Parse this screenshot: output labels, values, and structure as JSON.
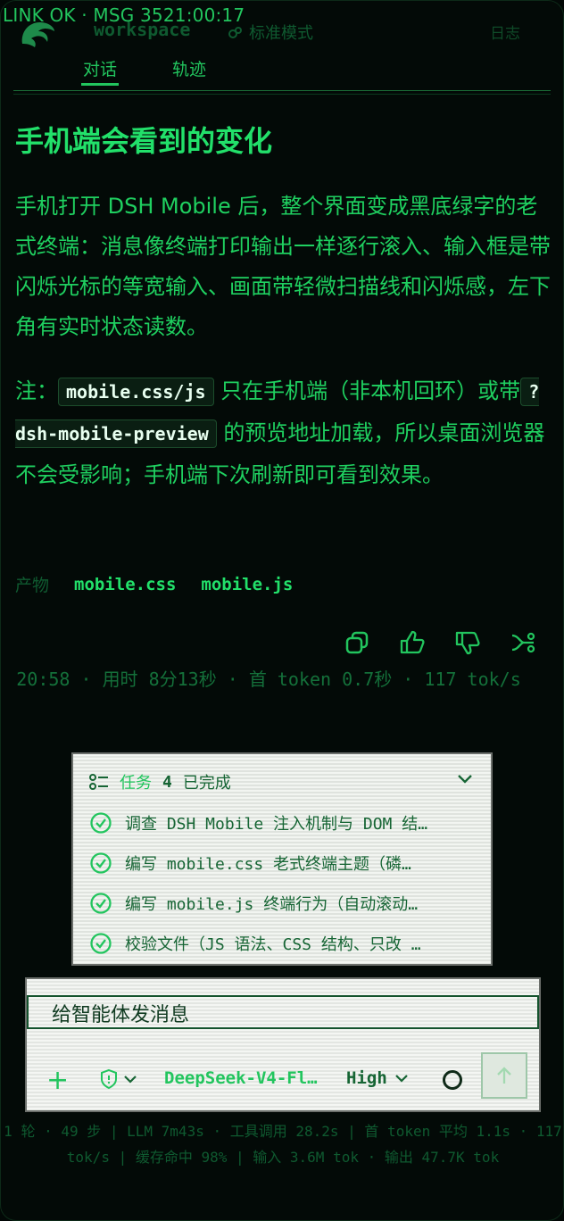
{
  "status_text": "LINK OK · MSG 3521:00:17",
  "header": {
    "workspace": "workspace",
    "mode": "标准模式",
    "log_link": "日志",
    "tabs": [
      {
        "label": "对话",
        "active": true
      },
      {
        "label": "轨迹",
        "active": false
      }
    ]
  },
  "message": {
    "title": "手机端会看到的变化",
    "para1": "手机打开 DSH Mobile 后，整个界面变成黑底绿字的老式终端：消息像终端打印输出一样逐行滚入、输入框是带闪烁光标的等宽输入、画面带轻微扫描线和闪烁感，左下角有实时状态读数。",
    "para2_a": "注：",
    "para2_code1": "mobile.css/js",
    "para2_b": "只在手机端（非本机回环）或带",
    "para2_code2": "?dsh-mobile-preview",
    "para2_c": "的预览地址加载，所以桌面浏览器不会受影响；手机端下次刷新即可看到效果。",
    "artifacts_label": "产物",
    "artifacts": [
      "mobile.css",
      "mobile.js"
    ],
    "actions": [
      "copy-icon",
      "thumbs-up-icon",
      "thumbs-down-icon",
      "branch-icon"
    ],
    "meta": "20:58 · 用时 8分13秒 · 首 token 0.7秒 · 117 tok/s"
  },
  "tasks": {
    "label": "任务",
    "count": "4",
    "status": "已完成",
    "items": [
      "调查 DSH Mobile 注入机制与 DOM 结…",
      "编写 mobile.css 老式终端主题（磷…",
      "编写 mobile.js 终端行为（自动滚动…",
      "校验文件（JS 语法、CSS 结构、只改 …"
    ]
  },
  "composer": {
    "placeholder": "给智能体发消息",
    "model": "DeepSeek-V4-Fl…",
    "level": "High"
  },
  "footer": "1 轮 · 49 步 | LLM 7m43s · 工具调用 28.2s | 首 token 平均 1.1s · 117 tok/s | 缓存命中 98% | 输入 3.6M tok · 输出 47.7K tok",
  "colors": {
    "accent": "#22c55e",
    "background": "#030a07"
  }
}
